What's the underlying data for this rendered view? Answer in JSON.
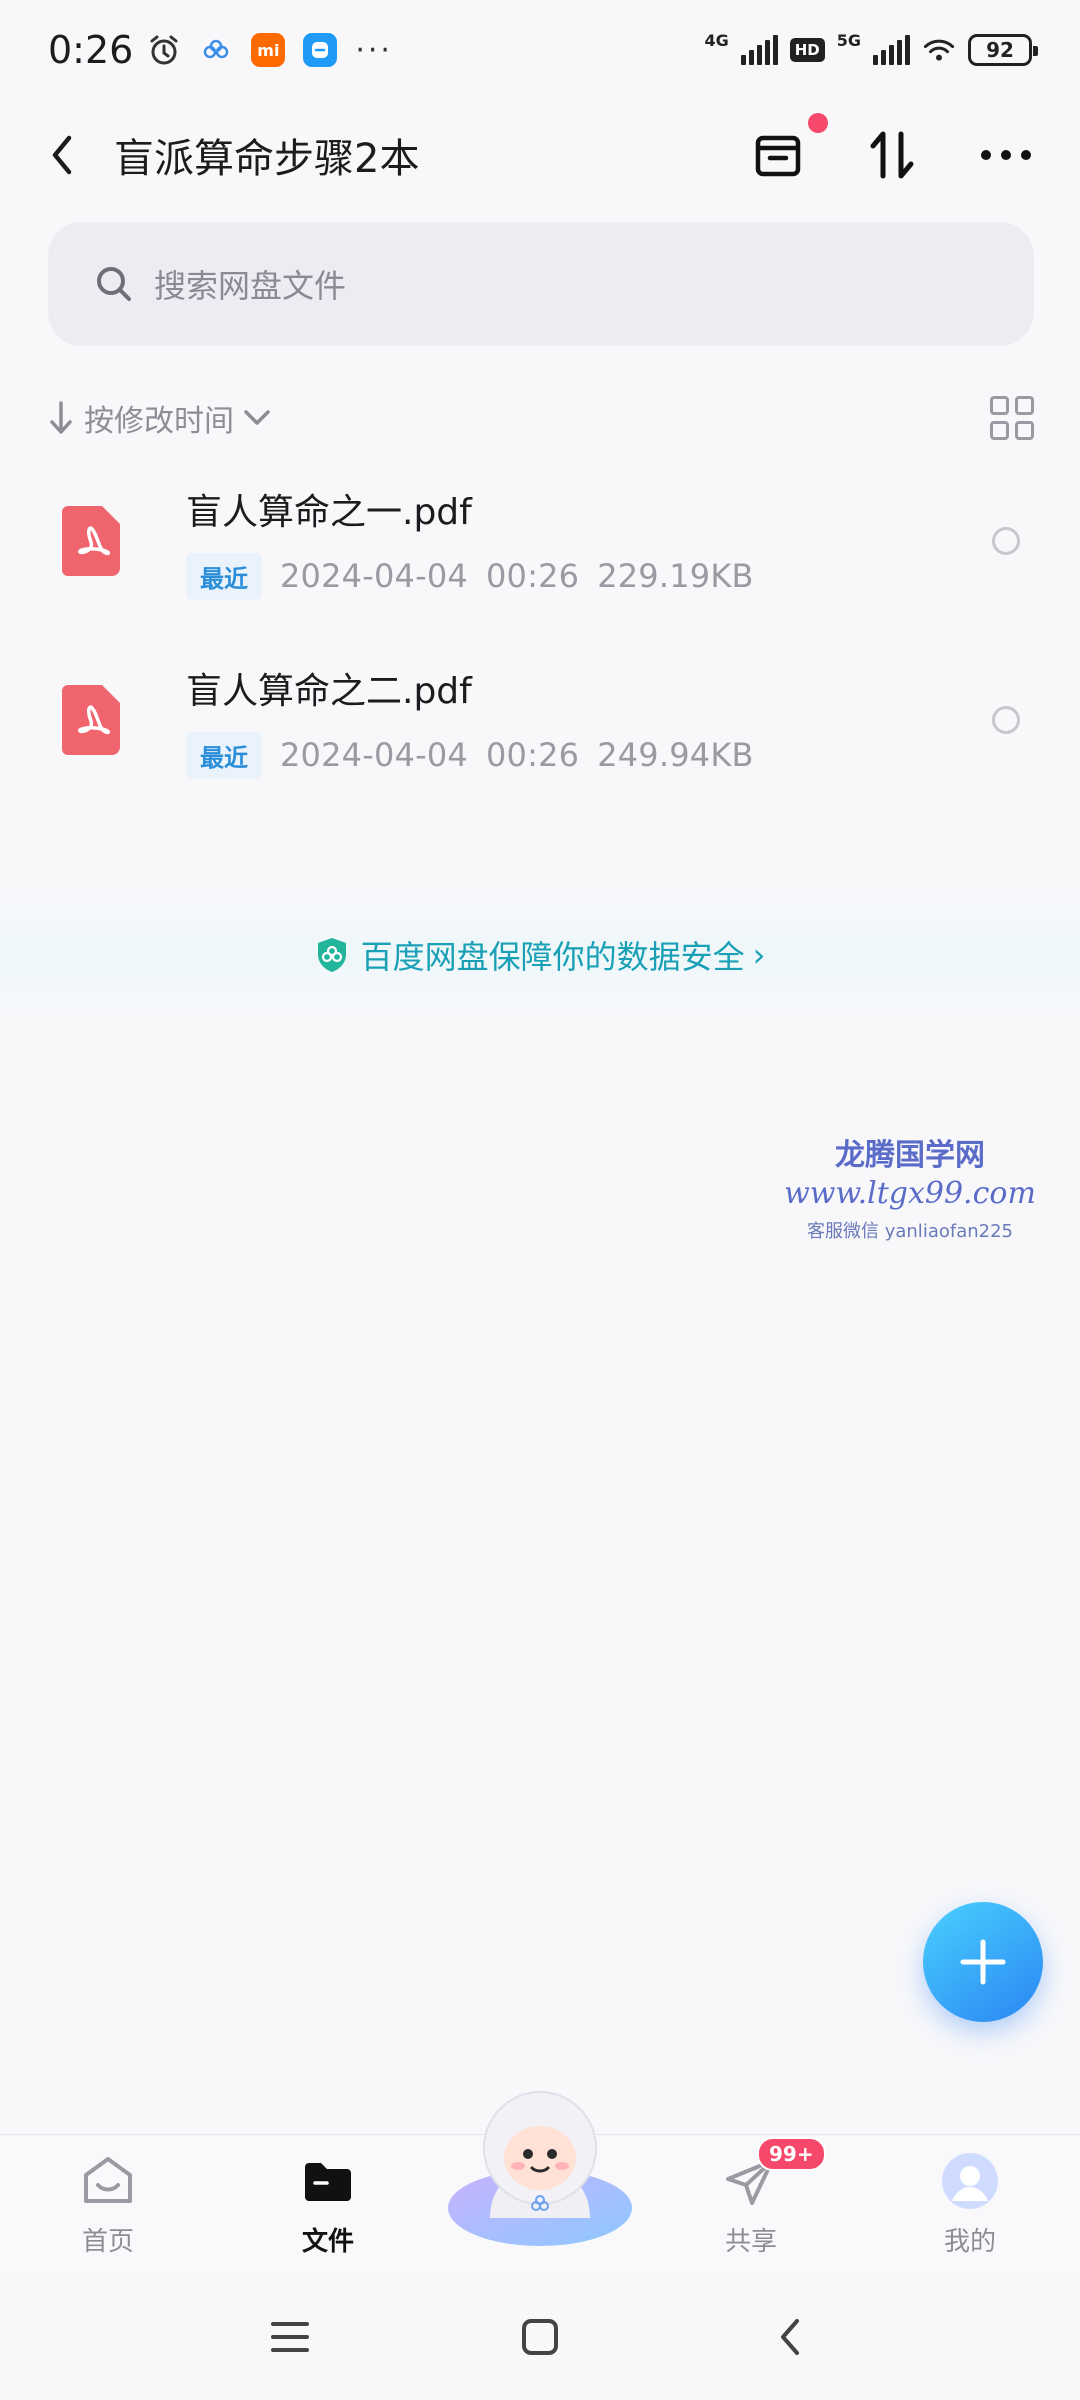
{
  "status_bar": {
    "time": "0:26",
    "network_1": "4G",
    "hd": "HD",
    "network_2": "5G",
    "battery": "92",
    "more": "···",
    "mi_badge": "mi"
  },
  "header": {
    "title": "盲派算命步骤2本"
  },
  "search": {
    "placeholder": "搜索网盘文件"
  },
  "sort": {
    "label": "按修改时间"
  },
  "files": [
    {
      "name": "盲人算命之一.pdf",
      "tag": "最近",
      "date": "2024-04-04",
      "time": "00:26",
      "size": "229.19KB"
    },
    {
      "name": "盲人算命之二.pdf",
      "tag": "最近",
      "date": "2024-04-04",
      "time": "00:26",
      "size": "249.94KB"
    }
  ],
  "security_banner": {
    "text": "百度网盘保障你的数据安全",
    "chevron": "›"
  },
  "watermark": {
    "line1": "龙腾国学网",
    "line2": "www.ltgx99.com",
    "line3": "客服微信 yanliaofan225"
  },
  "bottom_nav": {
    "items": [
      {
        "label": "首页",
        "active": false
      },
      {
        "label": "文件",
        "active": true
      },
      {
        "label": "共享",
        "active": false,
        "badge": "99+"
      },
      {
        "label": "我的",
        "active": false
      }
    ]
  },
  "colors": {
    "accent": "#2b8ed8",
    "security": "#1aa0b6",
    "badge": "#f5486b",
    "pdf": "#f0646e"
  }
}
